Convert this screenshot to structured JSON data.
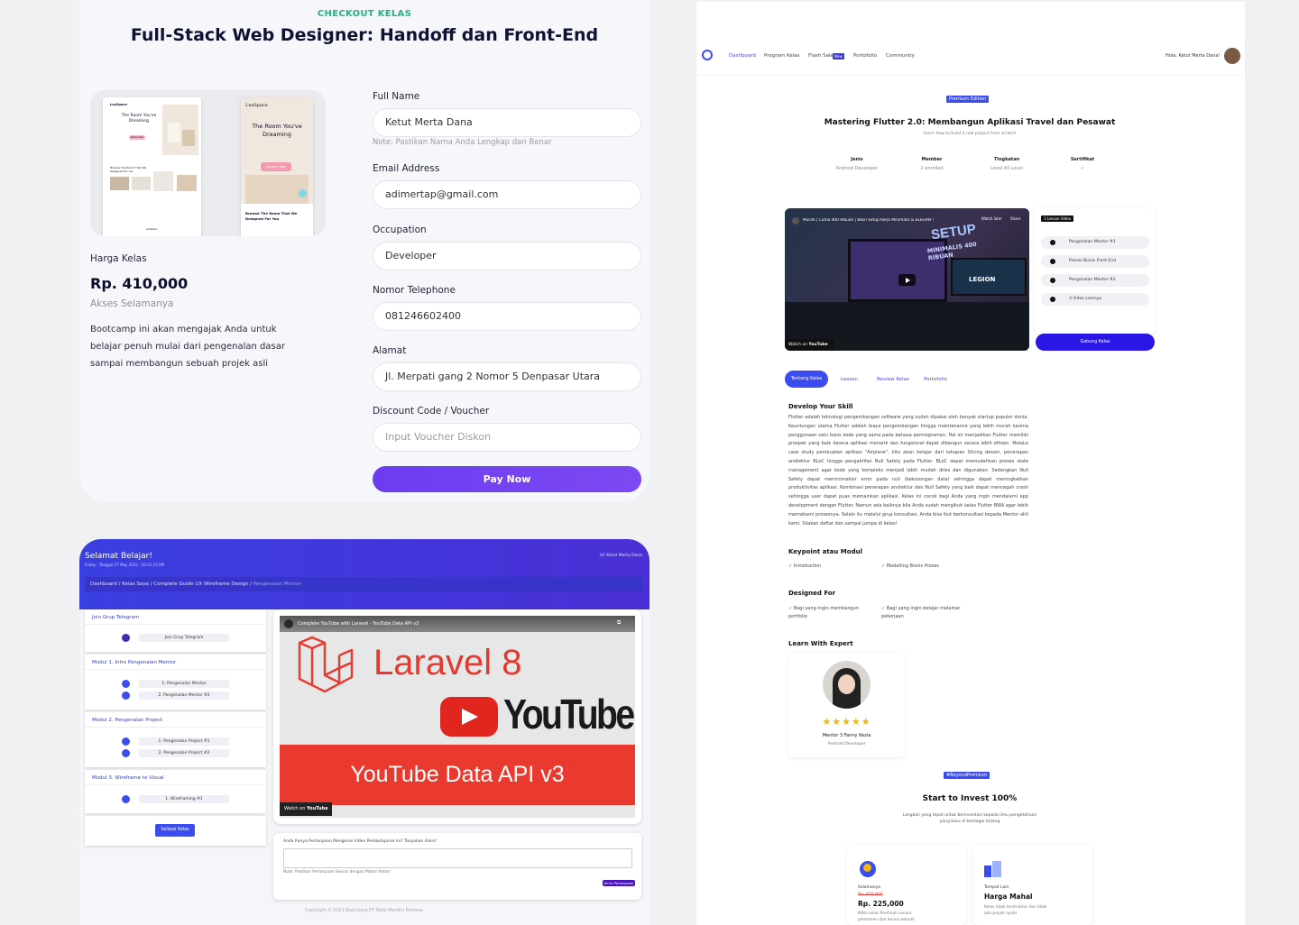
{
  "checkout": {
    "kicker": "CHECKOUT KELAS",
    "title": "Full-Stack Web Designer: Handoff dan Front-End",
    "thumb": {
      "brand": "LuxSpace",
      "headline": "The Room You've Dreaming",
      "explore": "Explore Now",
      "browse": "Browse The Room That We Designed For You"
    },
    "price_label": "Harga Kelas",
    "price": "Rp. 410,000",
    "access": "Akses Selamanya",
    "description": "Bootcamp ini akan mengajak Anda untuk belajar penuh mulai dari pengenalan dasar sampai membangun sebuah projek asli",
    "form": {
      "full_name_label": "Full Name",
      "full_name_value": "Ketut Merta Dana",
      "full_name_note": "Note: Pastikan Nama Anda Lengkap dan Benar",
      "email_label": "Email Address",
      "email_value": "adimertap@gmail.com",
      "occupation_label": "Occupation",
      "occupation_value": "Developer",
      "phone_label": "Nomor Telephone",
      "phone_value": "081246602400",
      "address_label": "Alamat",
      "address_value": "Jl. Merpati gang 2 Nomor 5 Denpasar Utara",
      "voucher_label": "Discount Code / Voucher",
      "voucher_placeholder": "Input Voucher Diskon",
      "pay_label": "Pay Now"
    }
  },
  "learn": {
    "title": "Selamat Belajar!",
    "date": "Friday - Tanggal 27 May 2022 - 03:22:33 PM",
    "greeting": "Hi! Ketut Merta Dana",
    "breadcrumb": [
      "Dashboard",
      "Kelas Saya",
      "Complete Guide UX Wireframe Design",
      "Pengenalan Mentor"
    ],
    "modules": [
      {
        "title": "Join Grup Telegram",
        "lessons": [
          "Join Grup Telegram"
        ]
      },
      {
        "title": "Modul 1. Intro Pengenalan Mentor",
        "lessons": [
          "1. Pengenalan Mentor",
          "2. Pengenalan Mentor #2"
        ]
      },
      {
        "title": "Modul 2. Pengenalan Project",
        "lessons": [
          "1. Pengenalan Project #1",
          "2. Pengenalan Project #2"
        ]
      },
      {
        "title": "Modul 3. Wireframe to Visual",
        "lessons": [
          "1. Wireframing #1"
        ]
      }
    ],
    "finish_btn": "Selesai Kelas",
    "video": {
      "title": "Complete YouTube with Laravel - YouTube Data API v3",
      "big1": "Laravel 8",
      "big2": "YouTube",
      "banner": "YouTube Data API v3",
      "watch_on": "Watch on",
      "yt": "YouTube"
    },
    "question_label": "Anda Punya Pertanyaan Mengenai Video Pembelajaran ini? Tanyakan disini!",
    "question_note": "Note: Pastikan Pertanyaan Sesuai dengan Materi Kelas!",
    "question_btn": "Kirim Pertanyaan",
    "copyright": "Copyright © 2021 Bootcamp PT Teiba Mandiri Perkasa."
  },
  "course": {
    "nav": [
      "Dashboard",
      "Program Kelas",
      "Flash Sale",
      "Portofolio",
      "Community"
    ],
    "new_badge": "New",
    "user": "Hola, Ketut Merta Dana!",
    "edition": "Premium Edition",
    "title": "Mastering Flutter 2.0: Membangun Aplikasi Travel dan Pesawat",
    "subtitle": "Learn how to build a real project from scratch",
    "stats": [
      {
        "label": "Jenis",
        "value": "Android Developer"
      },
      {
        "label": "Member",
        "value": "2 enrolled"
      },
      {
        "label": "Tingkatan",
        "value": "Level All Level"
      },
      {
        "label": "Sertifikat",
        "value": "✓"
      }
    ],
    "video": {
      "title": "Murah | Cuma 400 Ribuan | Bikin Setup Kerja Minimalis & ELEGAN !",
      "watch_later": "Watch later",
      "share": "Share",
      "setup": "SETUP",
      "minimalis": "MINIMALIS 400 RIBUAN",
      "legion": "LEGION",
      "watch_on": "Watch on",
      "yt": "YouTube"
    },
    "lesson_count": "3 Lesson Video",
    "lessons": [
      "Pengenalan Mentor #1",
      "Proses Bisnis Front End",
      "Pengenalan Mentor #2",
      "3 Video Lainnya"
    ],
    "join_btn": "Gabung Kelas",
    "tabs": [
      "Tentang Kelas",
      "Lesson",
      "Review Kelas",
      "Portofolio"
    ],
    "develop_title": "Develop Your Skill",
    "develop_text": "Flutter adalah teknologi pengembangan software yang sudah dipakai oleh banyak startup populer dunia. Keuntungan utama Flutter adalah biaya pengembangan hingga maintenance yang lebih murah karena penggunaan satu basis kode yang sama pada bahasa pemrograman. Hal ini menjadikan Flutter memiliki prospek yang baik karena aplikasi menarik dan fungsional dapat dibangun secara lebih efisien. Melalui case study pembuatan aplikasi \"Airplane\", kita akan belajar dari tahapan Slicing desain, penerapan arsitektur BLoC hingga pengaktifan Null Safety pada Flutter. BLoC dapat memudahkan proses state management agar kode yang kompleks menjadi lebih mudah dites dan digunakan. Sedangkan Null Safety dapat meminimalisir error pada null (kekosongan data) sehingga dapat meningkatkan produktivitas aplikasi. Kombinasi penerapan arsitektur dan Null Safety yang baik dapat mencegah crash sehingga user dapat puas memainkan aplikasi. Kelas ini cocok bagi Anda yang ingin mendalami app development dengan Flutter. Namun ada baiknya bila Anda sudah mengikuti kelas Flutter BWA agar lebih memahami prosesnya. Selain itu melalui grup konsultasi, Anda bisa ikut berkonsultasi kepada Mentor ahli kami. Silakan daftar dan sampai jumpa di kelas!",
    "keypoint_title": "Keypoint atau Modul",
    "keypoints": [
      "Introduction",
      "Modelling Bisnis Proses"
    ],
    "designed_title": "Designed For",
    "designed": [
      "Bagi yang ingin membangun portfolio",
      "Bagi yang ingin belajar melamar pekerjaan"
    ],
    "expert_title": "Learn With Expert",
    "mentor_stars": "★★★★★",
    "mentor_name": "Mentor 3 Fanny Kezia",
    "mentor_role": "Android Developer",
    "beyond_badge": "#BeyondPremium",
    "invest_title": "Start to Invest 100%",
    "invest_sub": "Langkah yang tepat untuk berinvestasi kepada ilmu pengetahuan yang baru di berbagai bidang",
    "plan1": {
      "label": "Selamanya",
      "old": "Rp. 450,000",
      "price": "Rp. 225,000",
      "desc": "Miliki kelas Premium secara permanen dan bonus sebuah"
    },
    "plan2": {
      "label": "Tempat Lain",
      "price": "Harga Mahal",
      "desc": "Kelas tidak terstruktur dan tidak ada projek nyata"
    }
  }
}
